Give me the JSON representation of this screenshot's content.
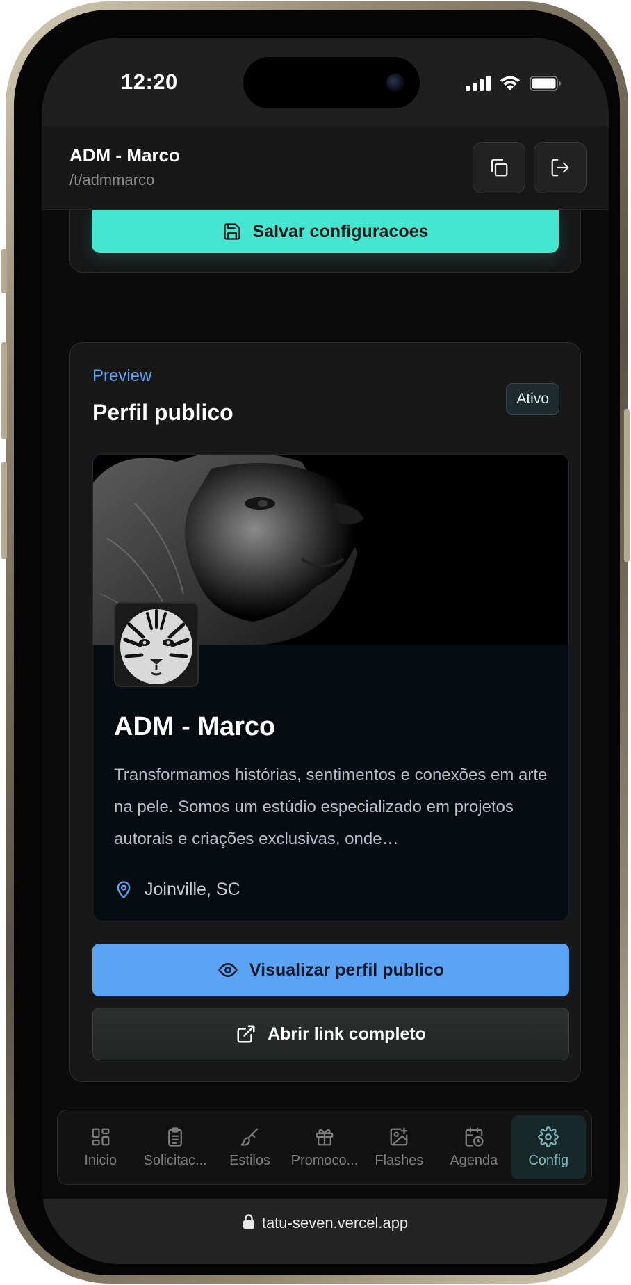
{
  "status_bar": {
    "time": "12:20"
  },
  "header": {
    "title": "ADM - Marco",
    "slug": "/t/admmarco",
    "copy_icon": "copy-icon",
    "logout_icon": "logout-icon"
  },
  "settings": {
    "save_label": "Salvar configuracoes",
    "save_icon": "floppy-disk-icon"
  },
  "preview": {
    "eyebrow": "Preview",
    "title": "Perfil publico",
    "badge": "Ativo",
    "profile": {
      "name": "ADM - Marco",
      "bio": "Transformamos histórias, sentimentos e conexões em arte na pele. Somos um estúdio especializado em projetos autorais e criações exclusivas, onde…",
      "location": "Joinville, SC",
      "location_icon": "map-pin-icon"
    },
    "view_button_label": "Visualizar perfil publico",
    "open_link_label": "Abrir link completo"
  },
  "bottom_nav": {
    "items": [
      {
        "label": "Inicio",
        "icon": "dashboard-icon"
      },
      {
        "label": "Solicitac...",
        "icon": "clipboard-icon"
      },
      {
        "label": "Estilos",
        "icon": "brush-icon"
      },
      {
        "label": "Promoco...",
        "icon": "gift-icon"
      },
      {
        "label": "Flashes",
        "icon": "image-plus-icon"
      },
      {
        "label": "Agenda",
        "icon": "calendar-clock-icon"
      },
      {
        "label": "Config",
        "icon": "gear-icon"
      }
    ],
    "active": "Config"
  },
  "browser": {
    "url": "tatu-seven.vercel.app"
  },
  "colors": {
    "accent_teal": "#45e6d0",
    "accent_blue": "#5ba3f5",
    "background": "#0b0b0b"
  }
}
